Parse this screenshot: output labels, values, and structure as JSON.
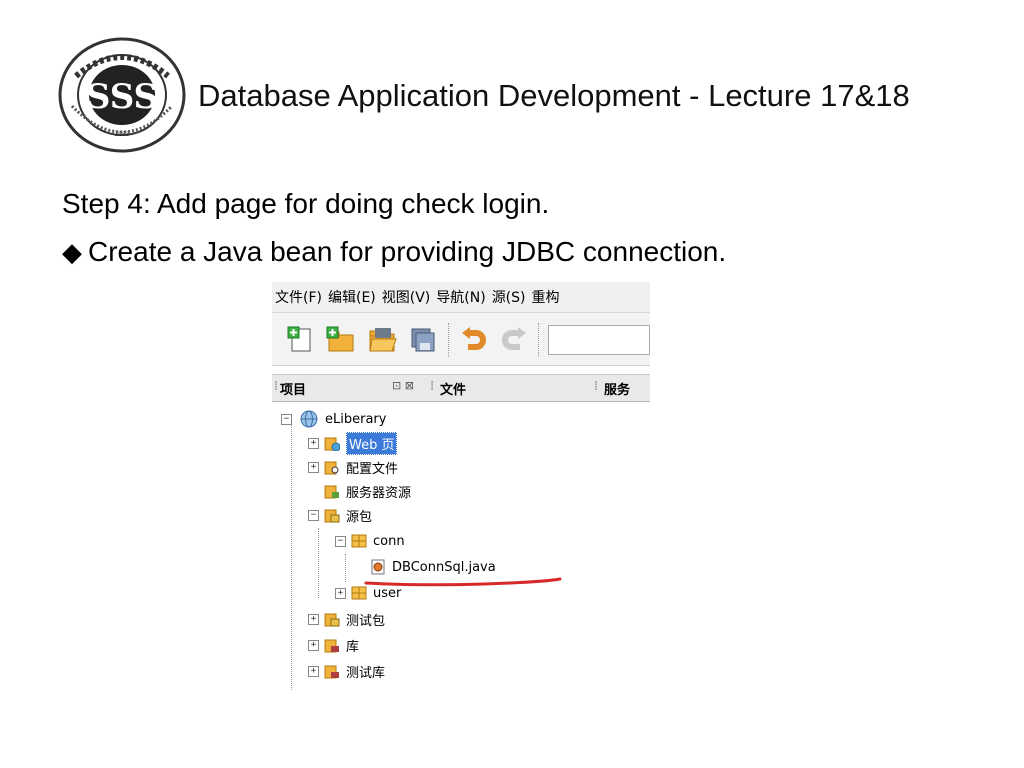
{
  "header": {
    "title": "Database Application Development - Lecture 17&18",
    "logo_icon": "university-seal-icon"
  },
  "body": {
    "step_text": "Step 4: Add page for doing check login.",
    "bullet_symbol": "◆",
    "bullet_text": "Create a Java bean for providing JDBC connection."
  },
  "ide": {
    "menu": [
      "文件(F)",
      "编辑(E)",
      "视图(V)",
      "导航(N)",
      "源(S)",
      "重构"
    ],
    "toolbar_icons": [
      "new-file-icon",
      "new-project-icon",
      "open-project-icon",
      "save-all-icon",
      "undo-icon",
      "redo-icon"
    ],
    "tabs": {
      "projects": "项目",
      "projects_controls": "⊡ ⊠",
      "files": "文件",
      "services": "服务"
    },
    "tree": {
      "root": "eLiberary",
      "web": "Web 页",
      "config": "配置文件",
      "server_res": "服务器资源",
      "src_pkg": "源包",
      "conn": "conn",
      "dbconn": "DBConnSql.java",
      "user": "user",
      "test_pkg": "测试包",
      "libs": "库",
      "test_libs": "测试库"
    },
    "highlight_color": "#d62a2a",
    "selection_color": "#3b7ad9"
  }
}
